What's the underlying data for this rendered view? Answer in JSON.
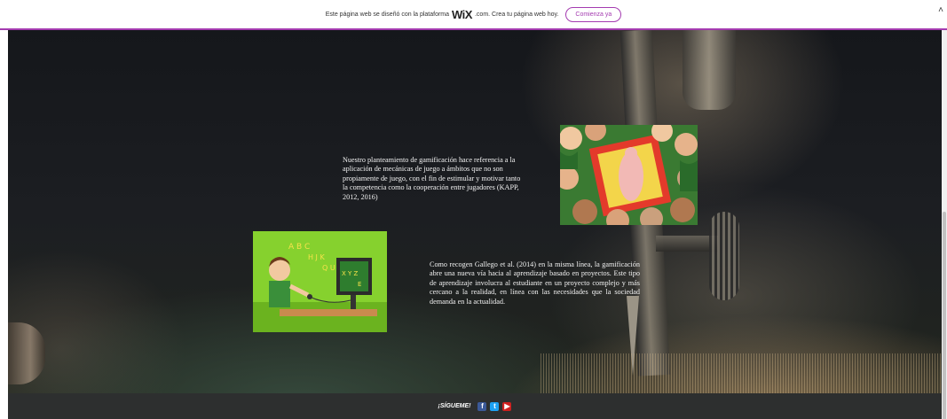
{
  "wix_banner": {
    "text_before": "Este página web se diseñó con la plataforma",
    "logo": "WiX",
    "text_after": ".com. Crea tu página web hoy.",
    "cta_label": "Comienza ya",
    "close_glyph": "˄"
  },
  "content": {
    "paragraph_1": "Nuestro planteamiento de gamificación hace referencia a la aplicación de mecánicas de juego a ámbitos que no son propiamente de juego, con el fin de estimular y motivar tanto la competencia como la cooperación entre jugadores (KAPP, 2012, 2016)",
    "paragraph_2": "Como recogen Gallego et al. (2014) en la misma línea, la gamificación abre una nueva vía hacia al aprendizaje basado en proyectos. Este tipo de aprendizaje involucra al estudiante en un proyecto complejo y más cercano a la realidad, en línea con las necesidades que la sociedad demanda en la actualidad."
  },
  "footer": {
    "follow_label": "¡SÍGUEME!",
    "social": [
      {
        "icon": "facebook-icon",
        "glyph": "f"
      },
      {
        "icon": "twitter-icon",
        "glyph": "t"
      },
      {
        "icon": "youtube-icon",
        "glyph": "▶"
      }
    ]
  },
  "colors": {
    "wix_accent": "#a43bb0",
    "footer_bg": "#2d2f2f",
    "facebook": "#3b5998",
    "twitter": "#1da1f2",
    "youtube": "#cd201f"
  }
}
